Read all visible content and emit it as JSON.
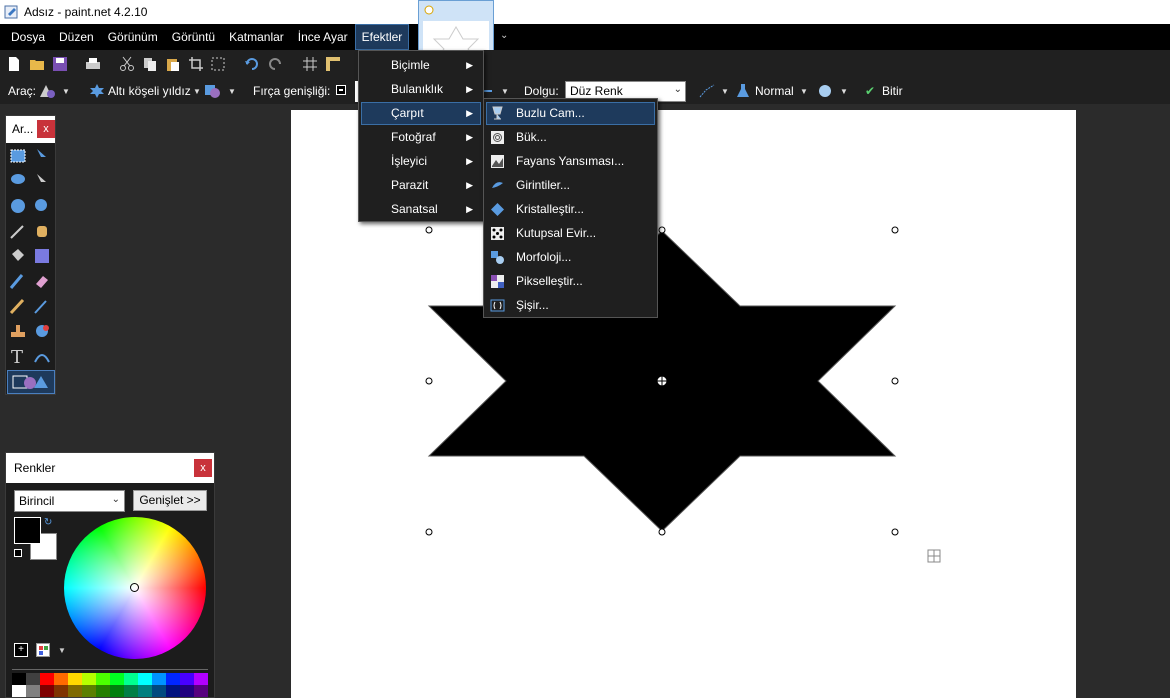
{
  "window": {
    "title": "Adsız - paint.net 4.2.10"
  },
  "menubar": [
    "Dosya",
    "Düzen",
    "Görünüm",
    "Görüntü",
    "Katmanlar",
    "İnce Ayar",
    "Efektler"
  ],
  "toolbar": {
    "tool_label": "Araç:",
    "shape_label": "Altı köşeli yıldız",
    "brush_width_label": "Fırça genişliği:",
    "fill_label": "Dolgu:",
    "fill_value": "Düz Renk",
    "blend_mode": "Normal",
    "finish_label": "Bitir"
  },
  "tools_panel": {
    "title": "Ar...",
    "close": "x"
  },
  "colors_panel": {
    "title": "Renkler",
    "close": "x",
    "mode": "Birincil",
    "expand": "Genişlet >>"
  },
  "effects_menu": [
    "Biçimle",
    "Bulanıklık",
    "Çarpıt",
    "Fotoğraf",
    "İşleyici",
    "Parazit",
    "Sanatsal"
  ],
  "distort_submenu": [
    "Buzlu Cam...",
    "Bük...",
    "Fayans Yansıması...",
    "Girintiler...",
    "Kristalleştir...",
    "Kutupsal Evir...",
    "Morfoloji...",
    "Pikselleştir...",
    "Şişir..."
  ],
  "palette": [
    "#000000",
    "#404040",
    "#ff0000",
    "#ff6a00",
    "#ffd800",
    "#b6ff00",
    "#4cff00",
    "#00ff21",
    "#00ff90",
    "#00ffff",
    "#0094ff",
    "#0026ff",
    "#4800ff",
    "#b200ff",
    "#ffffff",
    "#808080",
    "#7f0000",
    "#7f3300",
    "#7f6a00",
    "#5b7f00",
    "#267f00",
    "#007f0e",
    "#007f46",
    "#007f7f",
    "#004a7f",
    "#00137f",
    "#21007f",
    "#57007f"
  ]
}
